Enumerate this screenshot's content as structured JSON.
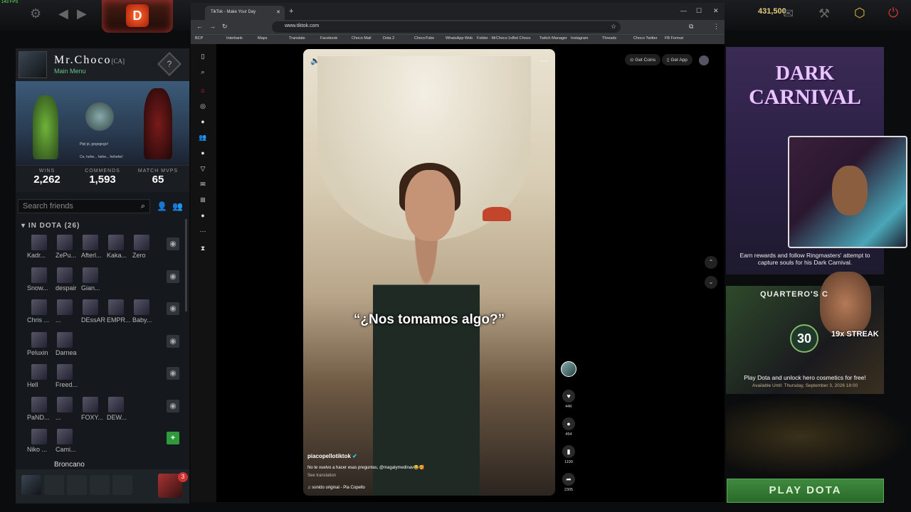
{
  "fps": "143 FPS",
  "shards": "431,500",
  "profile": {
    "name": "Mr.Choco",
    "tag": "[CA]",
    "subtitle": "Main Menu",
    "rank_symbol": "?"
  },
  "hero_lines": [
    "Pipi pi, gogogogo!",
    "Ce, hehe... hehe... hehehe!"
  ],
  "stats": [
    {
      "label": "WINS",
      "value": "2,262"
    },
    {
      "label": "COMMENDS",
      "value": "1,593"
    },
    {
      "label": "MATCH MVPS",
      "value": "65"
    }
  ],
  "friends": {
    "search_placeholder": "Search friends",
    "section": "IN DOTA (26)",
    "rows": [
      [
        "Kadr...",
        "ZePu...",
        "Afterl...",
        "Kaka...",
        "Zero"
      ],
      [
        "Snow...",
        "despair",
        "Gian..."
      ],
      [
        "Chris ...",
        "...",
        "DEssAR",
        "EMPR...",
        "Baby..."
      ],
      [
        "Peluxin",
        "Darnea"
      ],
      [
        "Hell",
        "Freed..."
      ],
      [
        "PaND...",
        "...",
        "FOXY...",
        "DEW..."
      ],
      [
        "Niko ...",
        "Cami..."
      ]
    ],
    "last": "Broncano",
    "badge_count": "3"
  },
  "browser": {
    "tab_title": "TikTok - Make Your Day",
    "url": "www.tiktok.com",
    "bookmarks": [
      "BCP",
      "Interbank",
      "Maps",
      "Translate",
      "Facebook",
      "Choco Mail",
      "Dota 2",
      "ChocoTube",
      "WhatsApp Web",
      "Folder - MrChoco",
      "1xBet Choco",
      "Twitch Manager",
      "Instagram",
      "Threads",
      "Choco Twitter",
      "FB Format"
    ]
  },
  "tiktok": {
    "caption": "“¿Nos tomamos algo?”",
    "username": "piacopellotiktok",
    "description": "No te vuelvo a hacer esas preguntas, @magalymedinav😂🥰",
    "see_translation": "See translation",
    "sound": "♫ sonido original - Pia Copello",
    "likes": "44K",
    "comments": "454",
    "saves": "1190",
    "shares": "2305",
    "get_coins": "Get Coins",
    "get_app": "Get App"
  },
  "event": {
    "title_line1": "DARK",
    "title_line2": "CARNIVAL",
    "description": "Earn rewards and follow Ringmasters' attempt to capture souls for his Dark Carnival."
  },
  "quarterly": {
    "title": "QUARTERO'S C",
    "number": "30",
    "streak": "19x STREAK",
    "description": "Play Dota and unlock hero cosmetics for free!",
    "available": "Available Until:  Thursday, September 3, 2026 18:00"
  },
  "play_button": "PLAY DOTA"
}
